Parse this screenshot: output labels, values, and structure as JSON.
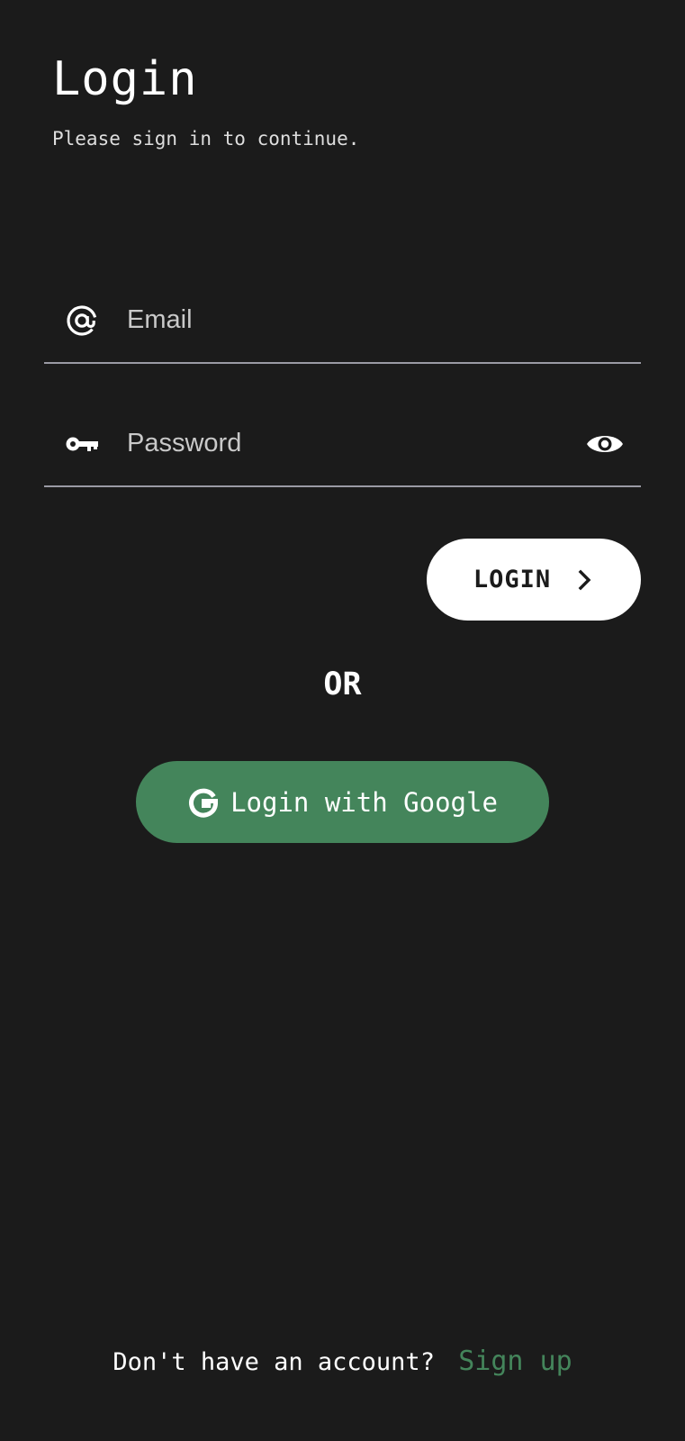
{
  "header": {
    "title": "Login",
    "subtitle": "Please sign in to continue."
  },
  "form": {
    "email": {
      "icon": "at-sign-icon",
      "placeholder": "Email",
      "value": ""
    },
    "password": {
      "icon": "key-icon",
      "placeholder": "Password",
      "value": "",
      "toggle_icon": "eye-icon"
    },
    "login_button": {
      "label": "LOGIN",
      "icon": "chevron-right-icon"
    }
  },
  "divider_text": "OR",
  "google_button": {
    "label": "Login with Google",
    "icon": "google-g-icon"
  },
  "footer": {
    "prompt": "Don't have an account?",
    "signup_link": "Sign up"
  },
  "colors": {
    "background": "#1b1b1b",
    "accent_green": "#44855b",
    "underline": "#9a9aa4",
    "button_white": "#ffffff"
  }
}
